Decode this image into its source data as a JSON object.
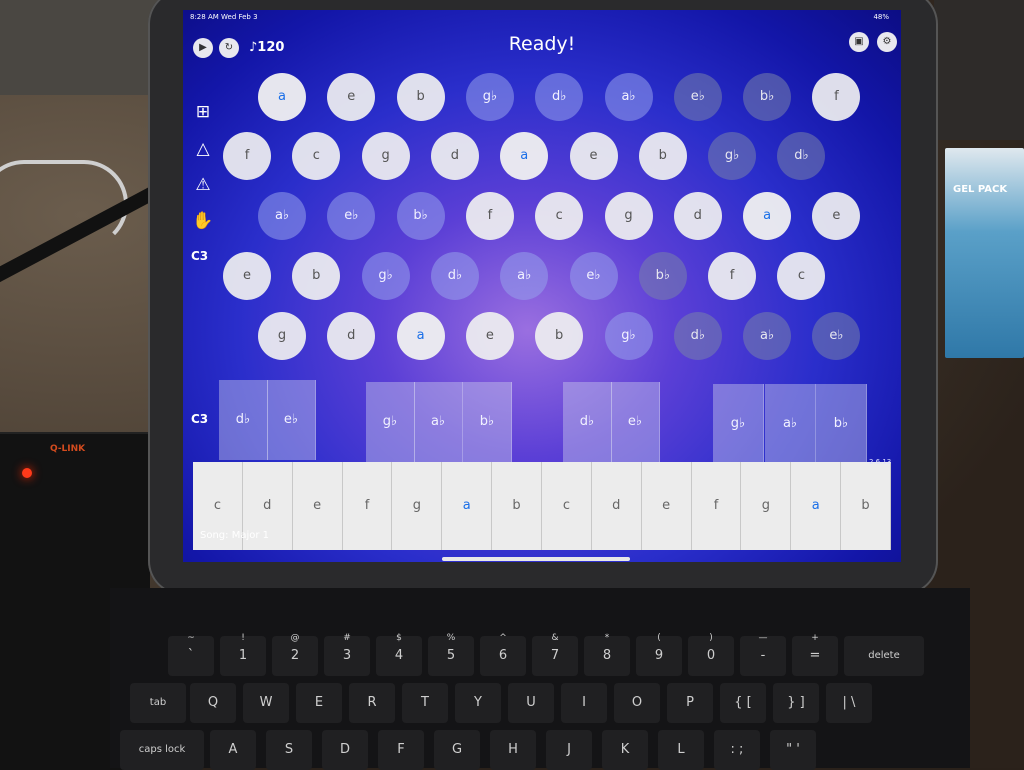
{
  "status_bar": {
    "time": "8:28 AM  Wed Feb 3",
    "battery": "48%"
  },
  "header": {
    "tempo": "♪120",
    "status": "Ready!"
  },
  "sidebar_label": "C3",
  "controls": {
    "play_icon": "play-icon",
    "reset_icon": "restart-icon",
    "inbox_icon": "inbox-icon",
    "settings_icon": "gear-icon"
  },
  "note_grid": {
    "rows": [
      [
        "a",
        "e",
        "b",
        "g♭",
        "d♭",
        "a♭",
        "e♭",
        "b♭",
        "f"
      ],
      [
        "f",
        "c",
        "g",
        "d",
        "a",
        "e",
        "b",
        "g♭",
        "d♭"
      ],
      [
        "a♭",
        "e♭",
        "b♭",
        "f",
        "c",
        "g",
        "d",
        "a",
        "e"
      ],
      [
        "e",
        "b",
        "g♭",
        "d♭",
        "a♭",
        "e♭",
        "b♭",
        "f",
        "c"
      ],
      [
        "g",
        "d",
        "a",
        "e",
        "b",
        "g♭",
        "d♭",
        "a♭",
        "e♭"
      ]
    ]
  },
  "piano": {
    "label": "C3",
    "black_keys": [
      "d♭",
      "e♭",
      "g♭",
      "a♭",
      "b♭",
      "d♭",
      "e♭",
      "g♭",
      "a♭",
      "b♭"
    ],
    "white_keys": [
      "c",
      "d",
      "e",
      "f",
      "g",
      "a",
      "b",
      "c",
      "d",
      "e",
      "f",
      "g",
      "a",
      "b"
    ]
  },
  "song": "Song: Major 1",
  "version": "2.6.13",
  "router_brand": "Q-LINK",
  "box_label": "GEL PACK",
  "keyboard": {
    "row1": [
      [
        "~",
        "`"
      ],
      [
        "!",
        "1"
      ],
      [
        "@",
        "2"
      ],
      [
        "#",
        "3"
      ],
      [
        "$",
        "4"
      ],
      [
        "%",
        "5"
      ],
      [
        "^",
        "6"
      ],
      [
        "&",
        "7"
      ],
      [
        "*",
        "8"
      ],
      [
        "(",
        "9"
      ],
      [
        ")",
        "0"
      ],
      [
        "—",
        "-"
      ],
      [
        "+",
        "="
      ],
      [
        "",
        "delete"
      ]
    ],
    "row2": [
      "tab",
      "Q",
      "W",
      "E",
      "R",
      "T",
      "Y",
      "U",
      "I",
      "O",
      "P",
      "{ [",
      "} ]",
      "| \\"
    ],
    "row3": [
      "caps lock",
      "A",
      "S",
      "D",
      "F",
      "G",
      "H",
      "J",
      "K",
      "L",
      ": ;",
      "\" '"
    ]
  }
}
